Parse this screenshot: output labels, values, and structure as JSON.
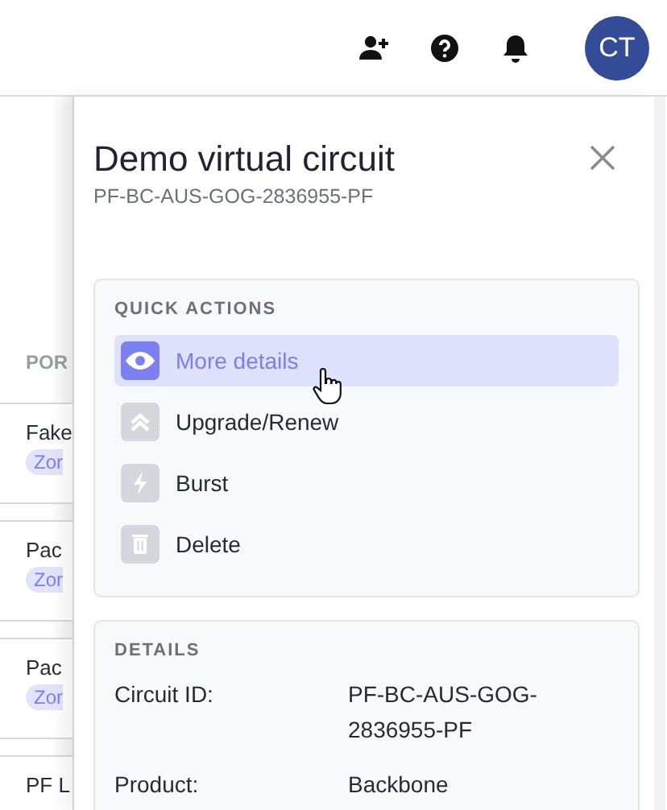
{
  "header": {
    "avatar": {
      "initials": "CT"
    }
  },
  "background_list": {
    "column_heading": "POR",
    "rows": [
      {
        "name": "Fake",
        "tag": "Zor"
      },
      {
        "name": "Pac",
        "tag": "Zor"
      },
      {
        "name": "Pac",
        "tag": "Zor"
      },
      {
        "name": "PF L"
      }
    ]
  },
  "panel": {
    "title": "Demo virtual circuit",
    "subtitle": "PF-BC-AUS-GOG-2836955-PF",
    "quick_actions": {
      "heading": "QUICK ACTIONS",
      "items": [
        {
          "kind": "details",
          "label": "More details",
          "selected": true
        },
        {
          "kind": "upgrade",
          "label": "Upgrade/Renew",
          "selected": false
        },
        {
          "kind": "burst",
          "label": "Burst",
          "selected": false
        },
        {
          "kind": "delete",
          "label": "Delete",
          "selected": false
        }
      ]
    },
    "details": {
      "heading": "DETAILS",
      "fields": [
        {
          "label": "Circuit ID:",
          "value": "PF-BC-AUS-GOG-2836955-PF"
        },
        {
          "label": "Product:",
          "value": "Backbone"
        }
      ]
    }
  }
}
